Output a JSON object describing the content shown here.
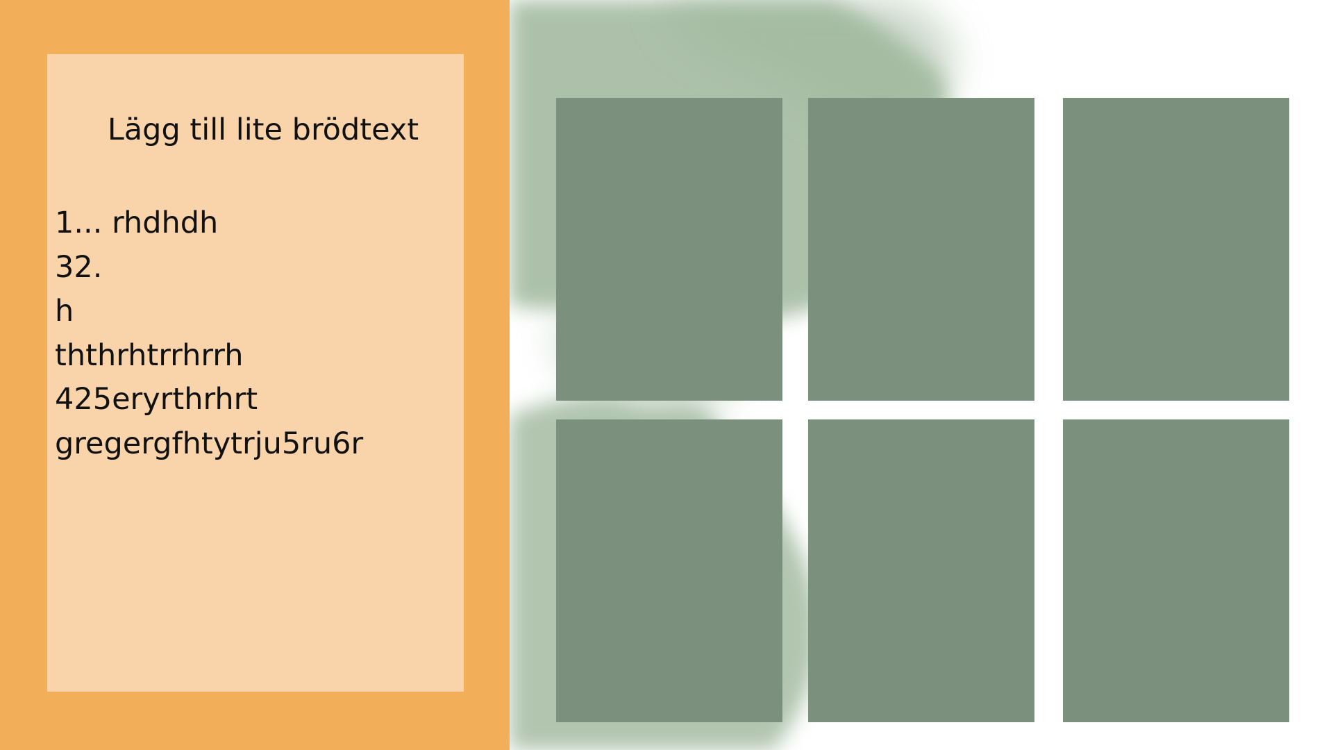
{
  "slide": {
    "heading": "Lägg till lite brödtext",
    "list_items": [
      "1... rhdhdh",
      "32.",
      "h",
      "ththrhtrrhrrh",
      "425eryrthrhrt",
      "gregergfhtytrju5ru6r"
    ]
  },
  "colors": {
    "panel_orange": "#f3ae59",
    "card_peach": "#f9d3a9",
    "tile_green": "#7c907e",
    "watercolor_green": "#9fb79c"
  }
}
